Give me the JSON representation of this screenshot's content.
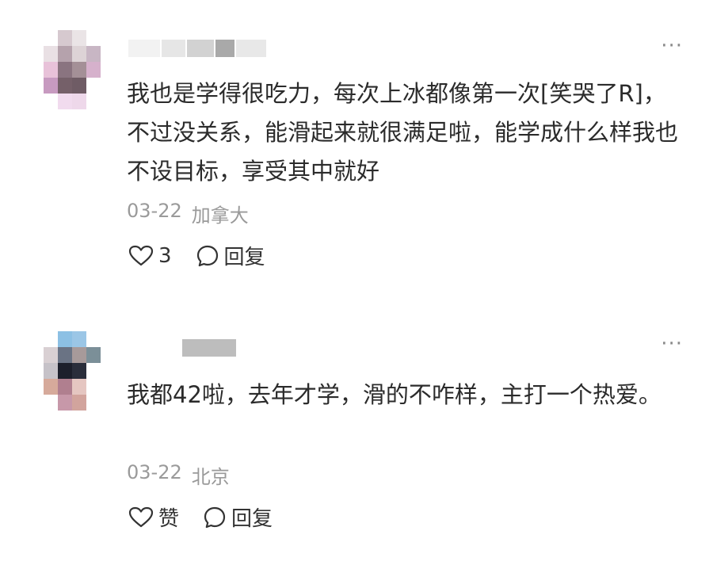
{
  "comments": [
    {
      "text": "我也是学得很吃力，每次上冰都像第一次[笑哭了R]，不过没关系，能滑起来就很满足啦，能学成什么样我也不设目标，享受其中就好",
      "date": "03-22",
      "location": "加拿大",
      "like_count": "3",
      "reply_label": "回复",
      "more_icon": "more-horizontal-icon"
    },
    {
      "text": "我都42啦，去年才学，滑的不咋样，主打一个热爱。",
      "date": "03-22",
      "location": "北京",
      "like_label": "赞",
      "reply_label": "回复",
      "more_icon": "more-horizontal-icon"
    }
  ],
  "colors": {
    "text": "#2b2b2b",
    "meta": "#9a9a9a",
    "icon": "#333333"
  }
}
